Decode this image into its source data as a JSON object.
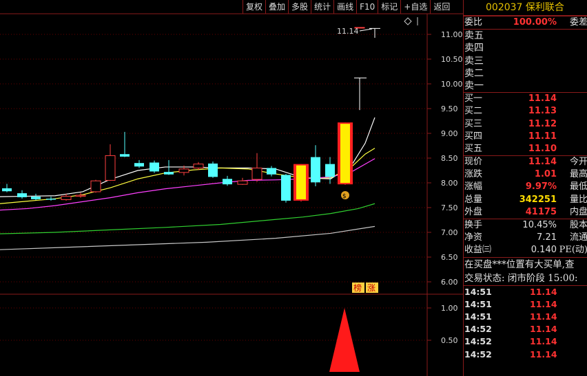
{
  "toolbar": {
    "buttons": [
      "复权",
      "叠加",
      "多股",
      "统计",
      "画线",
      "F10",
      "标记",
      "+自选",
      "返回"
    ]
  },
  "chart": {
    "price_labels": [
      "11.00",
      "10.50",
      "10.00",
      "9.50",
      "9.00",
      "8.50",
      "8.00",
      "7.50",
      "7.00",
      "6.50",
      "6.00"
    ],
    "vol_labels": [
      "1.00",
      "0.50"
    ],
    "high_label": "11.14",
    "tag1": "榜",
    "tag2": "涨",
    "money_icon": "money-bag-icon",
    "diamond_icon": "diamond-icon"
  },
  "panel": {
    "title": "002037 保利联合",
    "ratio": {
      "label": "委比",
      "value": "100.00%",
      "label2": "委差"
    },
    "sells": [
      "卖五",
      "卖四",
      "卖三",
      "卖二",
      "卖一"
    ],
    "buys": [
      {
        "label": "买一",
        "value": "11.14"
      },
      {
        "label": "买二",
        "value": "11.13"
      },
      {
        "label": "买三",
        "value": "11.12"
      },
      {
        "label": "买四",
        "value": "11.11"
      },
      {
        "label": "买五",
        "value": "11.10"
      }
    ],
    "stats": [
      {
        "label": "现价",
        "value": "11.14",
        "label2": "今开",
        "color": "red"
      },
      {
        "label": "涨跌",
        "value": "1.01",
        "label2": "最高",
        "color": "red"
      },
      {
        "label": "涨幅",
        "value": "9.97%",
        "label2": "最低",
        "color": "red"
      },
      {
        "label": "总量",
        "value": "342251",
        "label2": "量比",
        "color": "yellow"
      },
      {
        "label": "外盘",
        "value": "41175",
        "label2": "内盘",
        "color": "red"
      }
    ],
    "stats2": [
      {
        "label": "换手",
        "value": "10.45%",
        "label2": "股本"
      },
      {
        "label": "净资",
        "value": "7.21",
        "label2": "流通"
      },
      {
        "label": "收益㈢",
        "value": "0.140",
        "label2": "PE(动)"
      }
    ],
    "info1": "在买盘***位置有大买单,查",
    "info2": "交易状态: 闭市阶段 15:00:",
    "ticks": [
      {
        "time": "14:51",
        "price": "11.14"
      },
      {
        "time": "14:51",
        "price": "11.14"
      },
      {
        "time": "14:51",
        "price": "11.14"
      },
      {
        "time": "14:52",
        "price": "11.14"
      },
      {
        "time": "14:52",
        "price": "11.14"
      },
      {
        "time": "14:52",
        "price": "11.14"
      }
    ]
  }
}
